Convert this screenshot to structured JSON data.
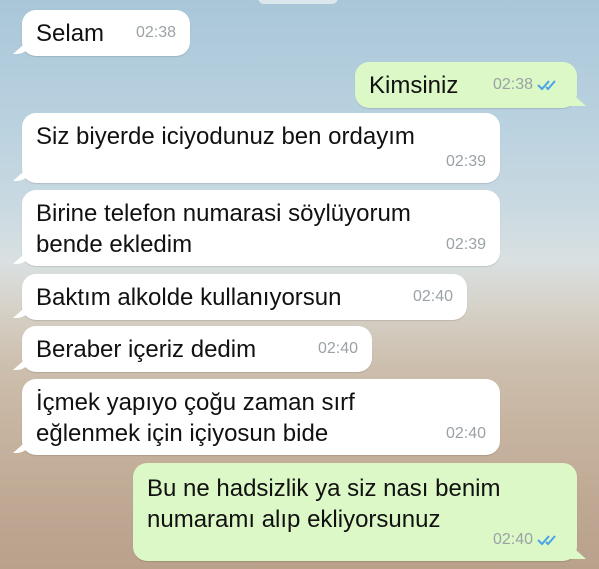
{
  "messages": [
    {
      "direction": "in",
      "text": "Selam",
      "time": "02:38"
    },
    {
      "direction": "out",
      "text": "Kimsiniz",
      "time": "02:38",
      "status": "read"
    },
    {
      "direction": "in",
      "text": "Siz biyerde iciyodunuz ben ordayım",
      "time": "02:39"
    },
    {
      "direction": "in",
      "text": "Birine telefon numarasi söylüyorum\nbende ekledim",
      "time": "02:39"
    },
    {
      "direction": "in",
      "text": "Baktım alkolde kullanıyorsun",
      "time": "02:40"
    },
    {
      "direction": "in",
      "text": "Beraber içeriz dedim",
      "time": "02:40"
    },
    {
      "direction": "in",
      "text": "İçmek yapıyo çoğu zaman sırf\neğlenmek için içiyosun bide",
      "time": "02:40"
    },
    {
      "direction": "out",
      "text": "Bu ne hadsizlik ya siz nası benim\nnumaramı alıp ekliyorsunuz",
      "time": "02:40",
      "status": "read"
    }
  ],
  "colors": {
    "incoming_bubble": "#ffffff",
    "outgoing_bubble": "#dcf8c6",
    "timestamp": "#9aa2a6",
    "read_ticks": "#4aa3e8"
  },
  "icons": {
    "read_receipt": "double-check-icon"
  }
}
